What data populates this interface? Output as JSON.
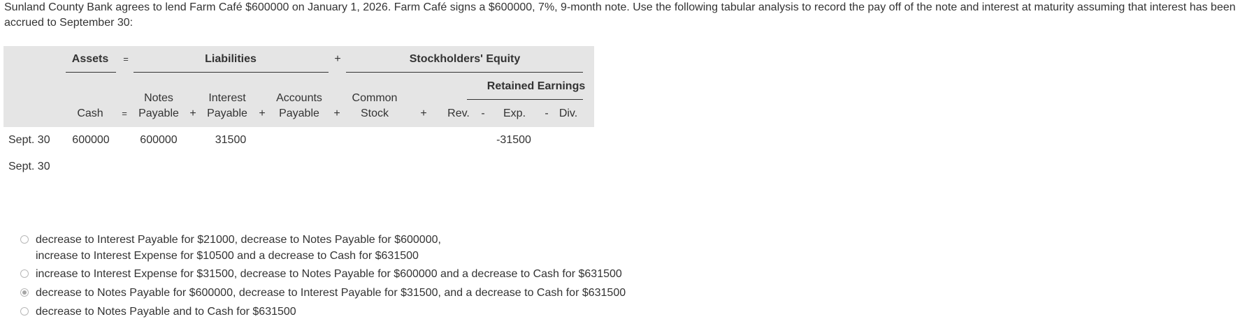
{
  "question": "Sunland County Bank agrees to lend Farm Café $600000 on January 1, 2026. Farm Café signs a $600000, 7%, 9-month note. Use the following tabular analysis to record the pay off of the note and interest at maturity assuming that interest has been accrued to September 30:",
  "table": {
    "header_top": {
      "assets": "Assets",
      "eq": "=",
      "liabilities": "Liabilities",
      "plus": "+",
      "equity": "Stockholders' Equity",
      "retained": "Retained Earnings"
    },
    "columns": {
      "cash": "Cash",
      "eq": "=",
      "notes_1": "Notes",
      "notes_2": "Payable",
      "plus1": "+",
      "interest_1": "Interest",
      "interest_2": "Payable",
      "plus2": "+",
      "accounts_1": "Accounts",
      "accounts_2": "Payable",
      "plus3": "+",
      "common_1": "Common",
      "common_2": "Stock",
      "plus4": "+",
      "rev": "Rev.",
      "minus1": "-",
      "exp": "Exp.",
      "minus2": "-",
      "div": "Div."
    },
    "rows": [
      {
        "label": "Sept. 30",
        "cash": "600000",
        "notes": "600000",
        "interest": "31500",
        "exp": "-31500"
      },
      {
        "label": "Sept. 30"
      }
    ]
  },
  "options": [
    {
      "line1": "decrease to Interest Payable for $21000, decrease to Notes Payable for $600000,",
      "line2": "increase to Interest Expense for $10500 and a decrease to Cash for $631500",
      "selected": false
    },
    {
      "line1": "increase to Interest Expense for $31500, decrease to Notes Payable for $600000 and a decrease to Cash for $631500",
      "selected": false
    },
    {
      "line1": "decrease to Notes Payable for $600000, decrease to Interest Payable for $31500, and a decrease to Cash for $631500",
      "selected": true
    },
    {
      "line1": "decrease to Notes Payable and to Cash for $631500",
      "selected": false
    }
  ]
}
